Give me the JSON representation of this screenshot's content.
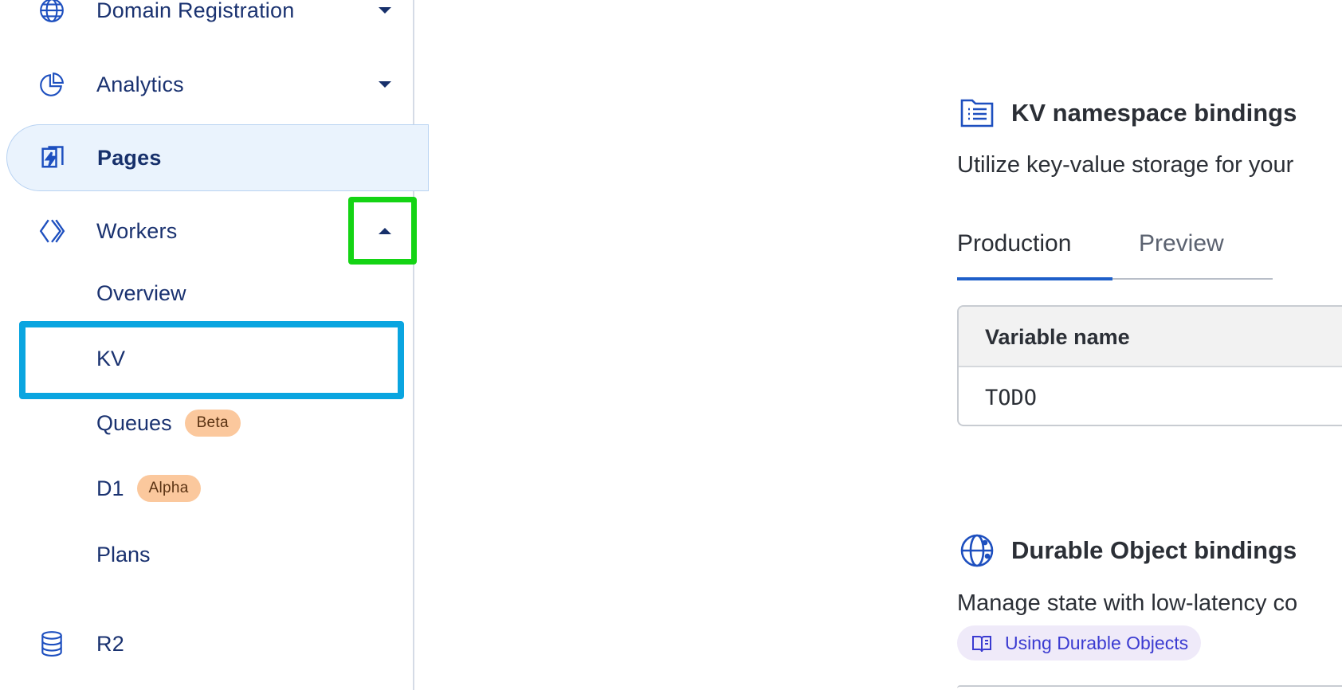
{
  "sidebar": {
    "items": [
      {
        "label": "Domain Registration",
        "icon": "globe-icon",
        "expanded": false
      },
      {
        "label": "Analytics",
        "icon": "pie-chart-icon",
        "expanded": false
      },
      {
        "label": "Pages",
        "icon": "pages-bolt-icon",
        "active": true
      },
      {
        "label": "Workers",
        "icon": "workers-icon",
        "expanded": true
      },
      {
        "label": "R2",
        "icon": "database-icon"
      }
    ],
    "workers_sub": [
      {
        "label": "Overview"
      },
      {
        "label": "KV"
      },
      {
        "label": "Queues",
        "badge": "Beta"
      },
      {
        "label": "D1",
        "badge": "Alpha"
      },
      {
        "label": "Plans"
      }
    ]
  },
  "kv_section": {
    "icon": "list-document-icon",
    "title": "KV namespace bindings",
    "description": "Utilize key-value storage for your",
    "tabs": [
      {
        "label": "Production",
        "active": true
      },
      {
        "label": "Preview",
        "active": false
      }
    ],
    "table": {
      "columns": [
        "Variable name"
      ],
      "rows": [
        [
          "TODO"
        ]
      ]
    }
  },
  "durable_section": {
    "icon": "globe-grid-icon",
    "title": "Durable Object bindings",
    "description": "Manage state with low-latency co",
    "link_label": "Using Durable Objects",
    "link_icon": "book-icon"
  },
  "colors": {
    "accent": "#1e5fc9",
    "active_bg": "#eaf3fd",
    "badge_bg": "#fbc89d",
    "highlight_green": "#14d414",
    "highlight_blue": "#0aa5e0"
  }
}
